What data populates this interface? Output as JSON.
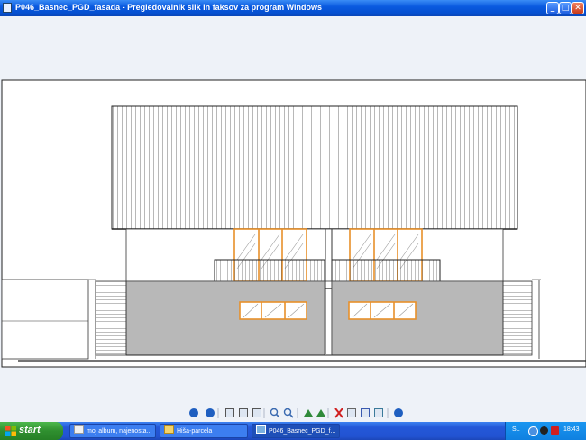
{
  "window": {
    "title": "P046_Basnec_PGD_fasada - Pregledovalnik slik in faksov za program Windows",
    "minimize_label": "_",
    "maximize_label": "□",
    "close_label": "✕"
  },
  "toolbar": {
    "buttons": [
      {
        "name": "previous-image-icon",
        "color": "#1f5fc0"
      },
      {
        "name": "next-image-icon",
        "color": "#1f5fc0"
      },
      {
        "name": "best-fit-icon",
        "color": "#555555"
      },
      {
        "name": "actual-size-icon",
        "color": "#555555"
      },
      {
        "name": "slideshow-icon",
        "color": "#555555"
      },
      {
        "name": "zoom-in-icon",
        "color": "#3a6ab0"
      },
      {
        "name": "zoom-out-icon",
        "color": "#3a6ab0"
      },
      {
        "name": "rotate-clockwise-icon",
        "color": "#2f8a3a"
      },
      {
        "name": "rotate-counterclockwise-icon",
        "color": "#2f8a3a"
      },
      {
        "name": "delete-icon",
        "color": "#d02020"
      },
      {
        "name": "print-icon",
        "color": "#666666"
      },
      {
        "name": "save-icon",
        "color": "#3a5ab0"
      },
      {
        "name": "edit-icon",
        "color": "#3a7a9a"
      },
      {
        "name": "help-icon",
        "color": "#1f5fc0"
      }
    ]
  },
  "taskbar": {
    "start_label": "start",
    "tasks": [
      {
        "label": "moj album, najenosta...",
        "icon": "browser-window-icon",
        "active": false
      },
      {
        "label": "Hiša-parcela",
        "icon": "folder-icon",
        "active": false
      },
      {
        "label": "P046_Basnec_PGD_f...",
        "icon": "image-viewer-icon",
        "active": true
      }
    ],
    "language": "SL",
    "clock": "18:43"
  },
  "colors": {
    "window_frame": "#0a5ae0",
    "viewer_background": "#eef2f8",
    "window_trim": "#e8902a",
    "wall_gray": "#b8b8b8"
  }
}
